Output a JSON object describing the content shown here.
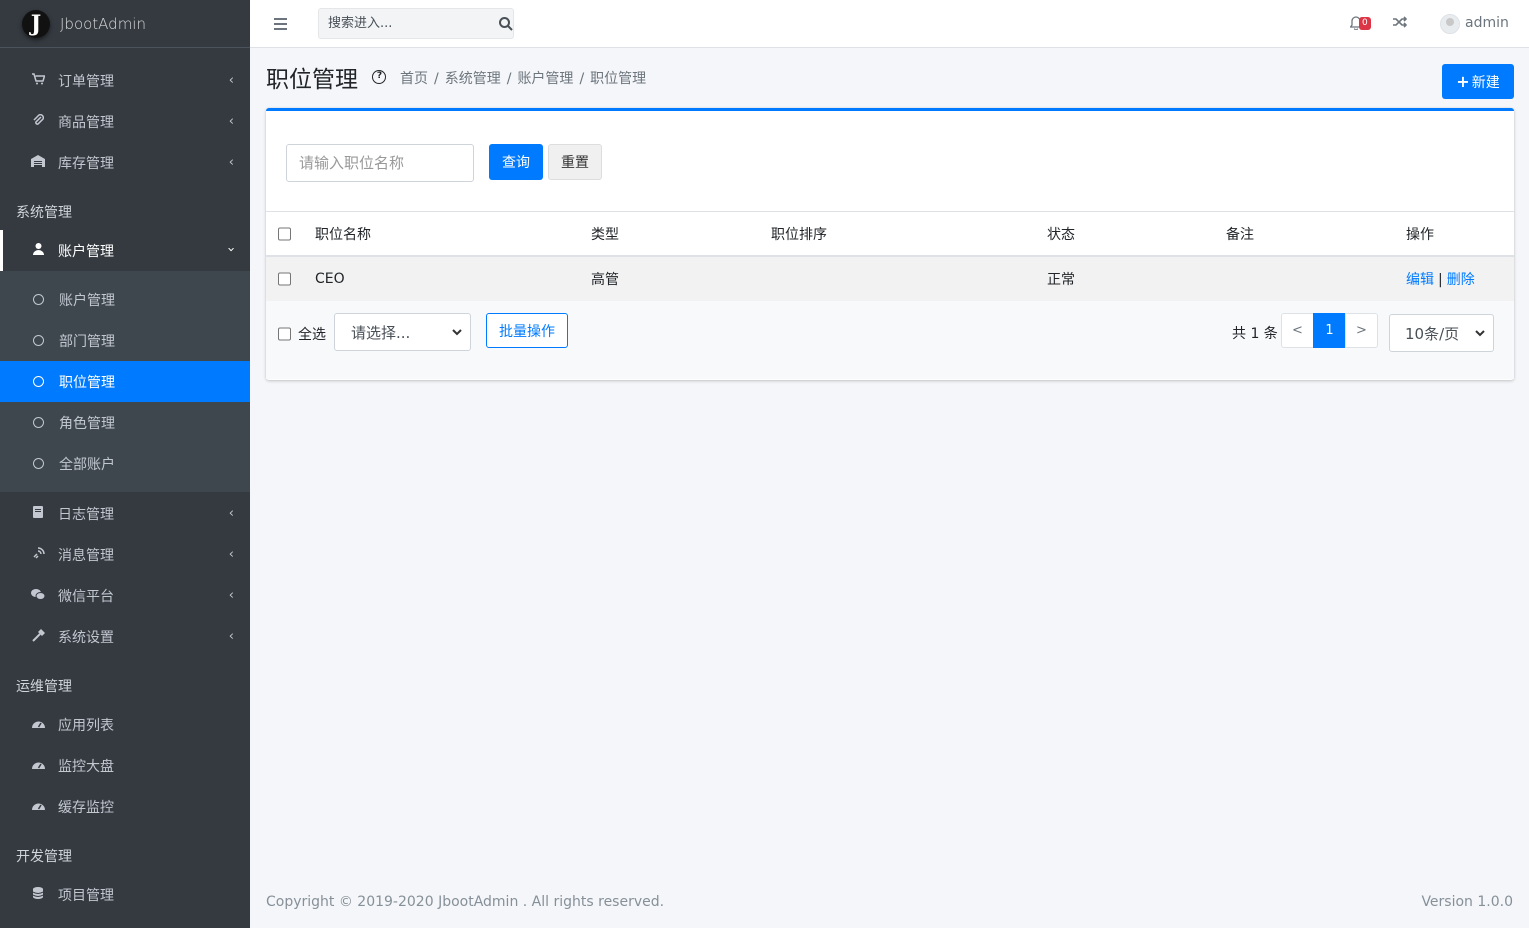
{
  "brand": {
    "logo_letter": "J",
    "name": "JbootAdmin"
  },
  "sidebar": {
    "group1": [
      {
        "label": "订单管理",
        "icon": "cart-icon"
      },
      {
        "label": "商品管理",
        "icon": "paperclip-icon"
      },
      {
        "label": "库存管理",
        "icon": "warehouse-icon"
      }
    ],
    "header_system": "系统管理",
    "account_parent": "账户管理",
    "account_sub": [
      {
        "label": "账户管理"
      },
      {
        "label": "部门管理"
      },
      {
        "label": "职位管理"
      },
      {
        "label": "角色管理"
      },
      {
        "label": "全部账户"
      }
    ],
    "group2": [
      {
        "label": "日志管理",
        "icon": "book-icon"
      },
      {
        "label": "消息管理",
        "icon": "message-icon"
      },
      {
        "label": "微信平台",
        "icon": "wechat-icon"
      },
      {
        "label": "系统设置",
        "icon": "hammer-icon"
      }
    ],
    "header_ops": "运维管理",
    "group3": [
      {
        "label": "应用列表",
        "icon": "gauge-icon"
      },
      {
        "label": "监控大盘",
        "icon": "gauge-icon"
      },
      {
        "label": "缓存监控",
        "icon": "gauge-icon"
      }
    ],
    "header_dev": "开发管理",
    "group4": [
      {
        "label": "项目管理",
        "icon": "database-icon"
      }
    ]
  },
  "topbar": {
    "search_placeholder": "搜索进入...",
    "notification_count": "0",
    "username": "admin"
  },
  "header": {
    "title": "职位管理",
    "breadcrumb": [
      "首页",
      "系统管理",
      "账户管理",
      "职位管理"
    ],
    "new_button": "新建"
  },
  "filter": {
    "placeholder": "请输入职位名称",
    "query_button": "查询",
    "reset_button": "重置"
  },
  "table": {
    "columns": [
      "职位名称",
      "类型",
      "职位排序",
      "状态",
      "备注",
      "操作"
    ],
    "rows": [
      {
        "name": "CEO",
        "type": "高管",
        "sort": "",
        "status": "正常",
        "remark": "",
        "edit": "编辑",
        "delete": "删除"
      }
    ]
  },
  "bulk": {
    "select_all": "全选",
    "select_placeholder": "请选择...",
    "batch_button": "批量操作"
  },
  "pagination": {
    "total_text": "共 1 条",
    "prev": "<",
    "current": "1",
    "next": ">",
    "page_size": "10条/页"
  },
  "footer": {
    "copyright": "Copyright © 2019-2020 JbootAdmin . All rights reserved.",
    "version": "Version 1.0.0"
  },
  "colors": {
    "primary": "#007bff",
    "sidebar_bg": "#343a40",
    "danger": "#dc3545"
  }
}
